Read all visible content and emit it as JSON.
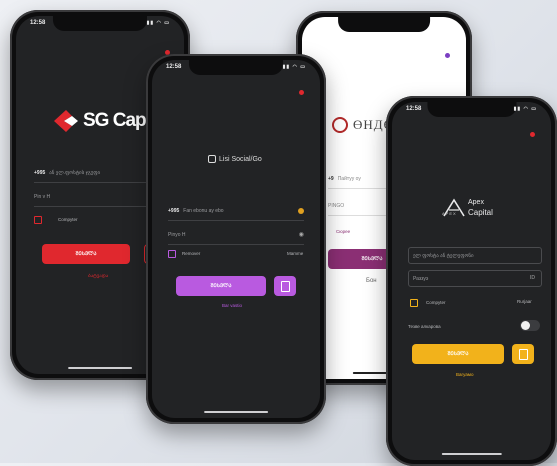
{
  "phones": {
    "p1": {
      "time": "12:58",
      "logo": "SG Capital",
      "prefix": "+995",
      "phone_placeholder": "ან ელ.ფოსტის ჯგუფი",
      "password_placeholder": "Pin v H",
      "remember_label": "Compyter",
      "button": "ᲨᲔᲡᲕᲚᲐ",
      "link": "Ბატვადა",
      "colors": {
        "button": "#e0282e",
        "flag": "#e0282e"
      }
    },
    "p2": {
      "time": "12:58",
      "logo": "Lisi Social/Go",
      "prefix": "+995",
      "phone_placeholder": "Fan ebonu ay ebo",
      "password_placeholder": "Pinyo H",
      "remember_label": "Remover",
      "forgot_label": "Mamme",
      "button": "ᲨᲔᲡᲕᲚᲐ",
      "link": "Bar vastio",
      "colors": {
        "button": "#b95ae0",
        "flag": "#e0282e"
      }
    },
    "p3": {
      "logo": "ӨНДӨ",
      "prefix": "+9",
      "phone_placeholder": "Пайтуу оу",
      "password_placeholder": "PINGO",
      "link_label": "Сюрее",
      "button": "ᲨᲔᲡᲕᲚᲐ",
      "footer_link": "Бон",
      "colors": {
        "button": "#8b2f74",
        "flag": "#7b3fc2",
        "logo_circle": "#b22a2a"
      }
    },
    "p4": {
      "time": "12:58",
      "logo_top": "Apex",
      "logo_bottom": "Capital",
      "logo_mark": "APEX",
      "phone_placeholder": "ელ ფოსტა ან ტელეფონი",
      "password_placeholder": "Раззуэ",
      "remember_label": "Compyter",
      "forgot_label": "Rurjaar",
      "biometric_label": "Тезве алкарова",
      "button": "ᲨᲔᲡᲕᲚᲐ",
      "link": "Вагуамо",
      "colors": {
        "button": "#f2b21b",
        "flag": "#e0282e"
      }
    }
  }
}
